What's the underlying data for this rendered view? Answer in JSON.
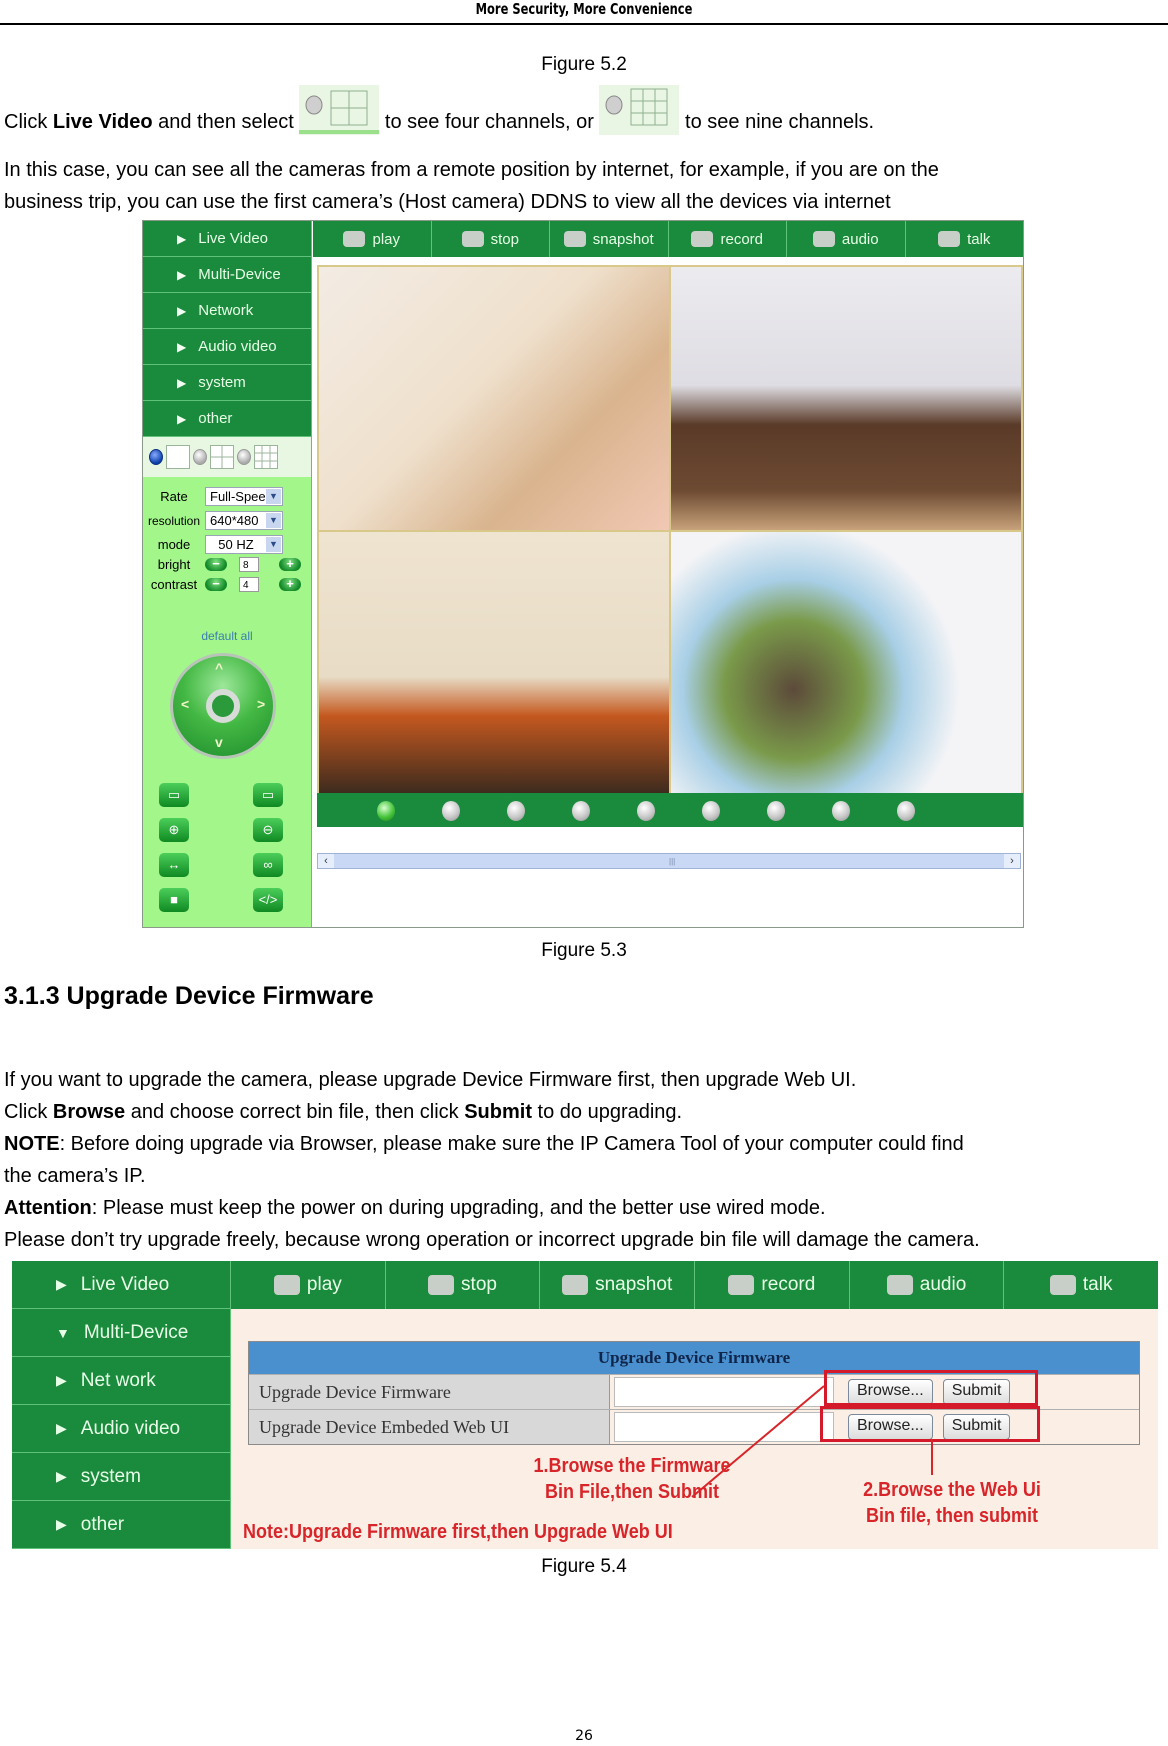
{
  "header": {
    "title": "More Security, More Convenience"
  },
  "captions": {
    "fig52": "Figure 5.2",
    "fig53": "Figure 5.3",
    "fig54": "Figure 5.4"
  },
  "intro": {
    "line1_pre": "Click ",
    "line1_bold": "Live Video",
    "line1_mid": " and then select ",
    "line1_mid2": " to see four channels, or ",
    "line1_post": " to see nine channels.",
    "icon_four": "four-channel-layout-icon",
    "icon_nine": "nine-channel-layout-icon",
    "line2": "In this case, you can see all the cameras from a remote position by internet, for example, if you are on the",
    "line3": "business trip, you can use the first camera’s (Host camera) DDNS to view all the devices via internet"
  },
  "fig53": {
    "nav": [
      {
        "label": "Live Video"
      },
      {
        "label": "Multi-Device"
      },
      {
        "label": "Network"
      },
      {
        "label": "Audio video"
      },
      {
        "label": "system"
      },
      {
        "label": "other"
      }
    ],
    "toolbar": [
      {
        "label": "play",
        "icon": "play-icon"
      },
      {
        "label": "stop",
        "icon": "stop-icon"
      },
      {
        "label": "snapshot",
        "icon": "camera-icon"
      },
      {
        "label": "record",
        "icon": "video-camera-icon"
      },
      {
        "label": "audio",
        "icon": "headphones-icon"
      },
      {
        "label": "talk",
        "icon": "microphone-icon"
      }
    ],
    "layout_selected": "single",
    "controls": {
      "rate_label": "Rate",
      "rate_value": "Full-Spee",
      "resolution_label": "resolution",
      "resolution_value": "640*480",
      "mode_label": "mode",
      "mode_value": "50 HZ",
      "bright_label": "bright",
      "bright_value": "8",
      "contrast_label": "contrast",
      "contrast_value": "4",
      "minus": "−",
      "plus": "+",
      "default_all": "default all"
    },
    "ptz": {
      "up": "^",
      "down": "v",
      "left": "<",
      "right": ">"
    },
    "aux_buttons": [
      {
        "icon": "flip-icon",
        "glyph": "▭"
      },
      {
        "icon": "mirror-icon",
        "glyph": "▭"
      },
      {
        "icon": "zoom-in-icon",
        "glyph": "⊕"
      },
      {
        "icon": "zoom-out-icon",
        "glyph": "⊖"
      },
      {
        "icon": "horizontal-patrol-icon",
        "glyph": "↔"
      },
      {
        "icon": "loop-icon",
        "glyph": "∞"
      },
      {
        "icon": "stop-patrol-icon",
        "glyph": "■"
      },
      {
        "icon": "code-icon",
        "glyph": "</>"
      }
    ],
    "channels_total": 9,
    "channel_active": 1,
    "scroll": {
      "left": "‹",
      "right": "›",
      "thumb": "|||"
    }
  },
  "section": {
    "heading": "3.1.3 Upgrade Device Firmware",
    "p1": "If you want to upgrade the camera, please upgrade Device Firmware first, then upgrade Web UI.",
    "p2_pre": "Click ",
    "p2_b1": "Browse",
    "p2_mid": " and choose correct bin file, then click ",
    "p2_b2": "Submit",
    "p2_post": " to do upgrading.",
    "p3_b": "NOTE",
    "p3": ": Before doing upgrade via Browser, please make sure the IP Camera Tool of your computer could find",
    "p3b": "the camera’s IP.",
    "p4_b": "Attention",
    "p4": ": Please must keep the power on during upgrading, and the better use wired mode.",
    "p5": "Please don’t try upgrade freely, because wrong operation or incorrect upgrade bin file will damage the camera."
  },
  "fig54": {
    "nav": [
      {
        "label": "Live Video",
        "arrow": "▶"
      },
      {
        "label": "Multi-Device",
        "arrow": "▼"
      },
      {
        "label": "Net work",
        "arrow": "▶"
      },
      {
        "label": "Audio video",
        "arrow": "▶"
      },
      {
        "label": "system",
        "arrow": "▶"
      },
      {
        "label": "other",
        "arrow": "▶"
      }
    ],
    "toolbar": [
      {
        "label": "play"
      },
      {
        "label": "stop"
      },
      {
        "label": "snapshot"
      },
      {
        "label": "record"
      },
      {
        "label": "audio"
      },
      {
        "label": "talk"
      }
    ],
    "table_title": "Upgrade Device Firmware",
    "rows": [
      {
        "label": "Upgrade Device Firmware",
        "browse": "Browse...",
        "submit": "Submit",
        "value": ""
      },
      {
        "label": "Upgrade Device Embeded Web UI",
        "browse": "Browse...",
        "submit": "Submit",
        "value": ""
      }
    ],
    "annotations": {
      "a1_line1": "1.Browse   the Firmware",
      "a1_line2": "Bin File,then Submit",
      "a2_line1": "2.Browse   the Web Ui",
      "a2_line2": "Bin file, then submit",
      "note": "Note:Upgrade Firmware first,then Upgrade Web UI"
    },
    "annotation_color": "#d8252a"
  },
  "footer": {
    "page_number": "26"
  },
  "colors": {
    "nav_green": "#1a8a3c",
    "panel_green": "#a3f78a",
    "table_header_blue": "#4a8fce"
  }
}
